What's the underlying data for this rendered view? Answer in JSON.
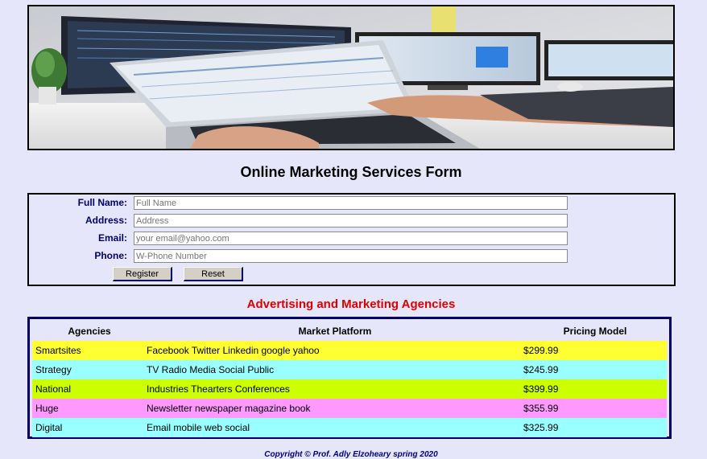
{
  "banner": {
    "icon": "laptop-workspace-photo"
  },
  "form": {
    "title": "Online Marketing Services Form",
    "fields": [
      {
        "label": "Full Name:",
        "placeholder": "Full Name"
      },
      {
        "label": "Address:",
        "placeholder": "Address"
      },
      {
        "label": "Email:",
        "placeholder": "your email@yahoo.com"
      },
      {
        "label": "Phone:",
        "placeholder": "W-Phone Number"
      }
    ],
    "register_label": "Register",
    "reset_label": "Reset"
  },
  "agencies": {
    "title": "Advertising and Marketing Agencies",
    "headers": [
      "Agencies",
      "Market Platform",
      "Pricing Model"
    ],
    "rows": [
      {
        "agency": "Smartsites",
        "platform": "Facebook Twitter Linkedin google yahoo",
        "price": "$299.99",
        "color": "#ffff33"
      },
      {
        "agency": "Strategy",
        "platform": "TV Radio Media Social Public",
        "price": "$245.99",
        "color": "#99ffff"
      },
      {
        "agency": "National",
        "platform": "Industries Thearters Conferences",
        "price": "$399.99",
        "color": "#ccff00"
      },
      {
        "agency": "Huge",
        "platform": "Newsletter newspaper magazine book",
        "price": "$355.99",
        "color": "#ff99ff"
      },
      {
        "agency": "Digital",
        "platform": "Email mobile web social",
        "price": "$325.99",
        "color": "#99ffff"
      }
    ]
  },
  "footer": {
    "copyright": "Copyright © Prof. Adly Elzoheary spring 2020"
  },
  "colors": {
    "background": "#e6e6fa",
    "title_red": "#e00000",
    "label_navy": "#00006e"
  }
}
